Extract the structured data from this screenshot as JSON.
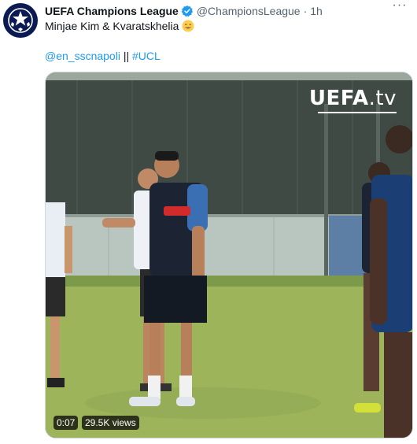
{
  "tweet": {
    "author_name": "UEFA Champions League",
    "author_handle": "@ChampionsLeague",
    "separator": "·",
    "timestamp": "1h",
    "more_label": "···",
    "text": "Minjae Kim & Kvaratskhelia",
    "mention": "@en_sscnapoli",
    "divider": "||",
    "hashtag": "#UCL"
  },
  "video": {
    "brand": "UEFA",
    "brand_suffix": ".tv",
    "duration": "0:07",
    "views": "29.5K views"
  },
  "colors": {
    "link": "#1d9bf0",
    "verified": "#1d9bf0",
    "secondary_text": "#536471",
    "avatar_bg": "#0b1a52"
  },
  "icons": [
    "verified-badge-icon",
    "more-options-icon",
    "grinning-emoji-icon",
    "starball-logo-icon"
  ]
}
